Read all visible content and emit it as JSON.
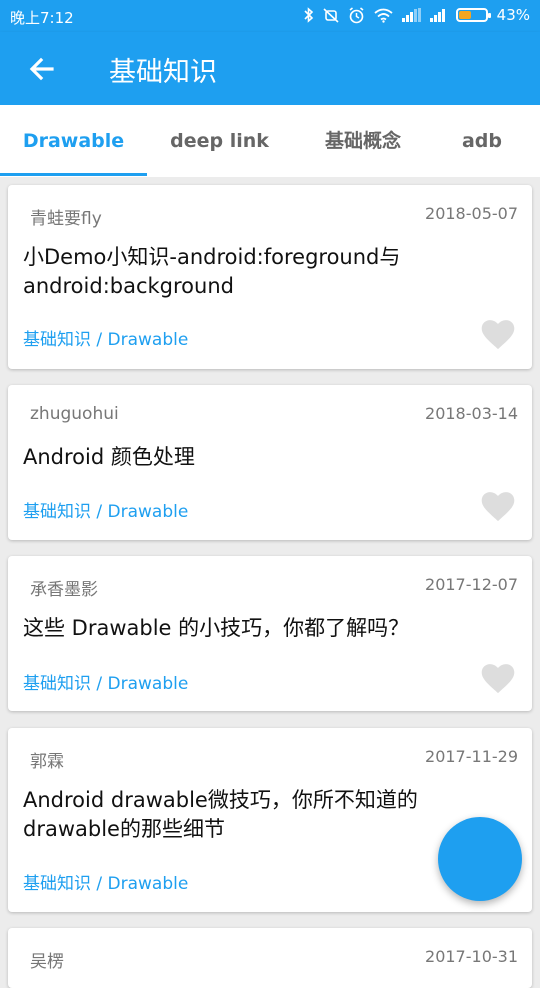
{
  "status_bar": {
    "time": "晚上7:12",
    "battery_percent": "43%",
    "icons": [
      "bluetooth-icon",
      "mute-icon",
      "alarm-icon",
      "wifi-icon",
      "signal-icon",
      "signal-icon",
      "battery-icon"
    ]
  },
  "app_bar": {
    "title": "基础知识",
    "back_icon": "arrow-left-icon"
  },
  "tabs": [
    {
      "label": "Drawable",
      "selected": true
    },
    {
      "label": "deep link",
      "selected": false
    },
    {
      "label": "基础概念",
      "selected": false
    },
    {
      "label": "adb",
      "selected": false
    }
  ],
  "articles": [
    {
      "author": "青蛙要fly",
      "date": "2018-05-07",
      "title": "小Demo小知识-android:foreground与android:background",
      "chapter": "基础知识 / Drawable"
    },
    {
      "author": "zhuguohui",
      "date": "2018-03-14",
      "title": "Android 颜色处理",
      "chapter": "基础知识 / Drawable"
    },
    {
      "author": "承香墨影",
      "date": "2017-12-07",
      "title": "这些 Drawable 的小技巧，你都了解吗？",
      "chapter": "基础知识 / Drawable"
    },
    {
      "author": "郭霖",
      "date": "2017-11-29",
      "title": "Android drawable微技巧，你所不知道的drawable的那些细节",
      "chapter": "基础知识 / Drawable"
    },
    {
      "author": "吴楞",
      "date": "2017-10-31"
    }
  ],
  "fab": {
    "icon": "airplane-icon"
  },
  "colors": {
    "primary": "#1e9ff0",
    "background": "#ececec",
    "heart": "#dddddd"
  }
}
